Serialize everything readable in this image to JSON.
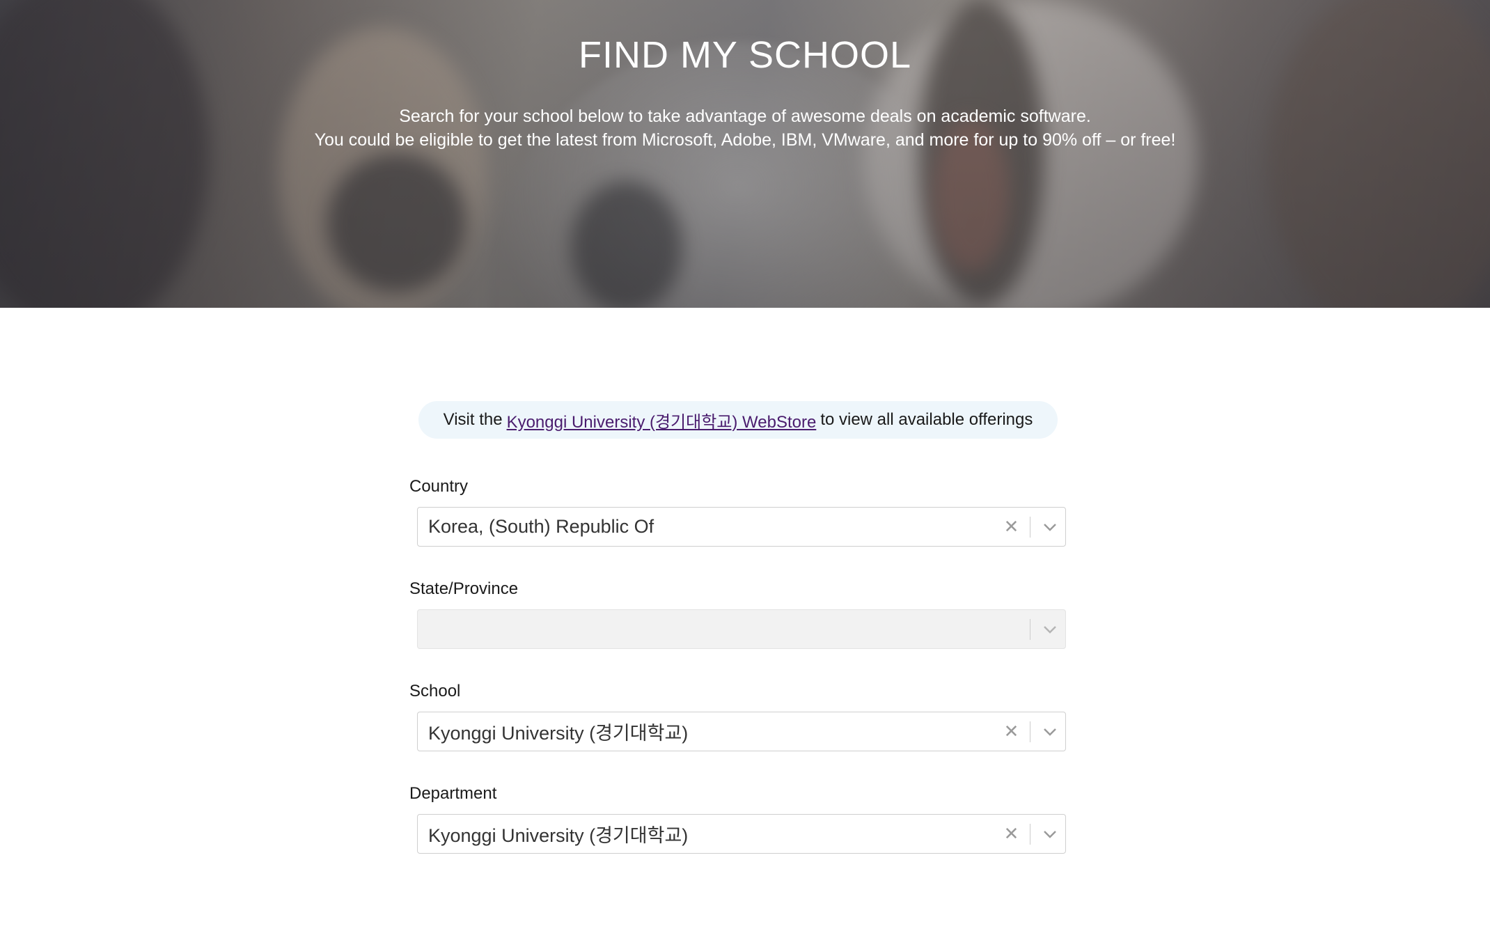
{
  "hero": {
    "title": "FIND MY SCHOOL",
    "subtitle_line1": "Search for your school below to take advantage of awesome deals on academic software.",
    "subtitle_line2": "You could be eligible to get the latest from Microsoft, Adobe, IBM, VMware, and more for up to 90% off – or free!"
  },
  "notice": {
    "prefix": "Visit the",
    "link_text": "Kyonggi University (경기대학교) WebStore",
    "suffix": "to view all available offerings"
  },
  "fields": {
    "country": {
      "label": "Country",
      "value": "Korea, (South) Republic Of"
    },
    "state": {
      "label": "State/Province",
      "value": ""
    },
    "school": {
      "label": "School",
      "value": "Kyonggi University (경기대학교)"
    },
    "department": {
      "label": "Department",
      "value": "Kyonggi University (경기대학교)"
    }
  },
  "icons": {
    "clear": "close-icon",
    "dropdown": "chevron-down-icon"
  },
  "colors": {
    "link": "#4a1c6e",
    "notice_bg": "#eef6fb",
    "disabled_bg": "#f2f2f2"
  }
}
